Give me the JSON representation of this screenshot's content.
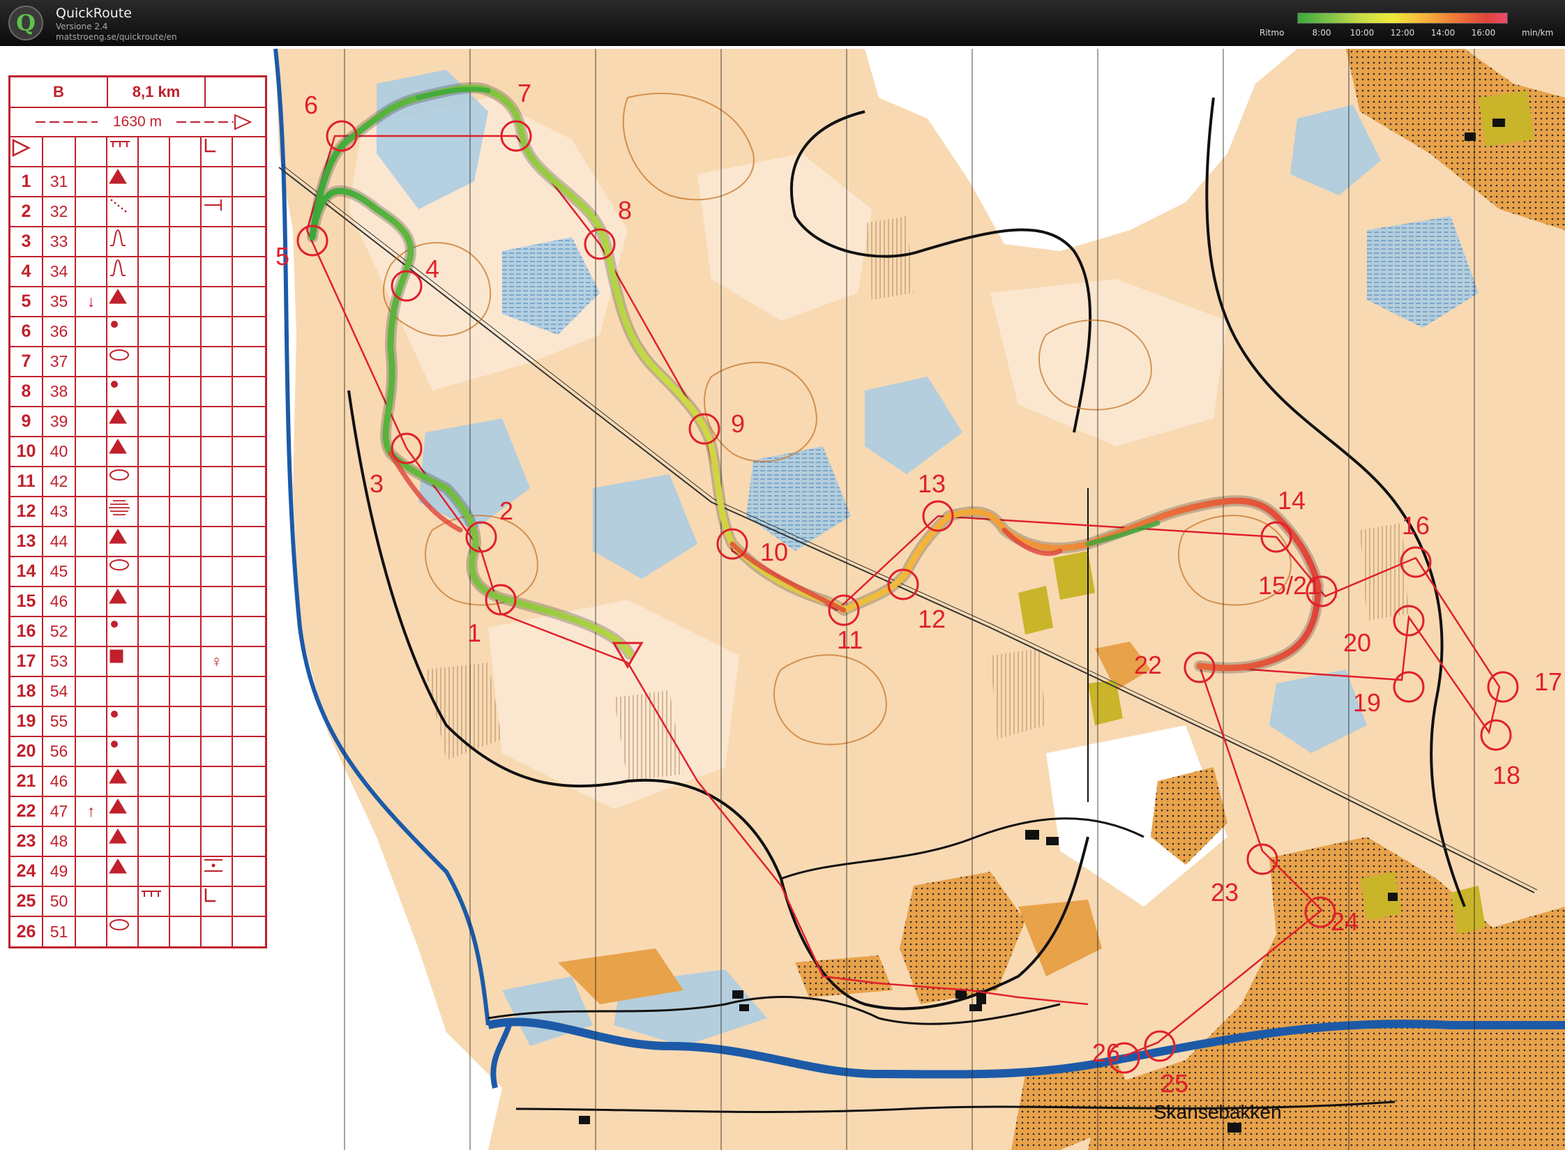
{
  "header": {
    "app_name": "QuickRoute",
    "version": "Versione 2.4",
    "url": "matstroeng.se/quickroute/en",
    "legend_title": "Ritmo",
    "legend_ticks": [
      "8:00",
      "10:00",
      "12:00",
      "14:00",
      "16:00"
    ],
    "legend_unit": "min/km",
    "legend_colors": [
      "#3aa83a",
      "#c8dc44",
      "#eeea3c",
      "#f5b63a",
      "#e0443a"
    ]
  },
  "course": {
    "class": "B",
    "length": "8,1 km",
    "marked_route": "1630 m",
    "controls": [
      {
        "num": "1",
        "code": "31",
        "dir": "",
        "feature": "knoll",
        "extra": ""
      },
      {
        "num": "2",
        "code": "32",
        "dir": "",
        "feature": "ditch-end",
        "extra": "T"
      },
      {
        "num": "3",
        "code": "33",
        "dir": "",
        "feature": "gully",
        "extra": ""
      },
      {
        "num": "4",
        "code": "34",
        "dir": "",
        "feature": "gully",
        "extra": ""
      },
      {
        "num": "5",
        "code": "35",
        "dir": "↓",
        "feature": "knoll",
        "extra": ""
      },
      {
        "num": "6",
        "code": "36",
        "dir": "",
        "feature": "dot",
        "extra": ""
      },
      {
        "num": "7",
        "code": "37",
        "dir": "",
        "feature": "oval",
        "extra": ""
      },
      {
        "num": "8",
        "code": "38",
        "dir": "",
        "feature": "dot",
        "extra": ""
      },
      {
        "num": "9",
        "code": "39",
        "dir": "",
        "feature": "knoll",
        "extra": ""
      },
      {
        "num": "10",
        "code": "40",
        "dir": "",
        "feature": "knoll",
        "extra": ""
      },
      {
        "num": "11",
        "code": "42",
        "dir": "",
        "feature": "oval",
        "extra": ""
      },
      {
        "num": "12",
        "code": "43",
        "dir": "",
        "feature": "marsh",
        "extra": ""
      },
      {
        "num": "13",
        "code": "44",
        "dir": "",
        "feature": "knoll",
        "extra": ""
      },
      {
        "num": "14",
        "code": "45",
        "dir": "",
        "feature": "oval",
        "extra": ""
      },
      {
        "num": "15",
        "code": "46",
        "dir": "",
        "feature": "knoll",
        "extra": ""
      },
      {
        "num": "16",
        "code": "52",
        "dir": "",
        "feature": "dot",
        "extra": ""
      },
      {
        "num": "17",
        "code": "53",
        "dir": "",
        "feature": "square",
        "extra": "♀"
      },
      {
        "num": "18",
        "code": "54",
        "dir": "",
        "feature": "",
        "extra": ""
      },
      {
        "num": "19",
        "code": "55",
        "dir": "",
        "feature": "dot",
        "extra": ""
      },
      {
        "num": "20",
        "code": "56",
        "dir": "",
        "feature": "dot",
        "extra": ""
      },
      {
        "num": "21",
        "code": "46",
        "dir": "",
        "feature": "knoll",
        "extra": ""
      },
      {
        "num": "22",
        "code": "47",
        "dir": "↑",
        "feature": "knoll",
        "extra": ""
      },
      {
        "num": "23",
        "code": "48",
        "dir": "",
        "feature": "knoll",
        "extra": ""
      },
      {
        "num": "24",
        "code": "49",
        "dir": "",
        "feature": "knoll",
        "extra": "bench"
      },
      {
        "num": "25",
        "code": "50",
        "dir": "",
        "feature": "fence",
        "extra": "corner"
      },
      {
        "num": "26",
        "code": "51",
        "dir": "",
        "feature": "oval",
        "extra": ""
      }
    ]
  },
  "map_labels": {
    "controls": [
      "1",
      "2",
      "3",
      "4",
      "5",
      "6",
      "7",
      "8",
      "9",
      "10",
      "11",
      "12",
      "13",
      "14",
      "15/21",
      "16",
      "17",
      "18",
      "19",
      "20",
      "22",
      "23",
      "24",
      "25",
      "26"
    ],
    "place_name": "Skansebakken"
  },
  "colors": {
    "control_red": "#e0202c",
    "open_land": "#f3c690",
    "marsh_blue": "#7fb3d6",
    "water": "#1c5aa8",
    "settlement": "#e8a24a",
    "building": "#c9b42a"
  }
}
